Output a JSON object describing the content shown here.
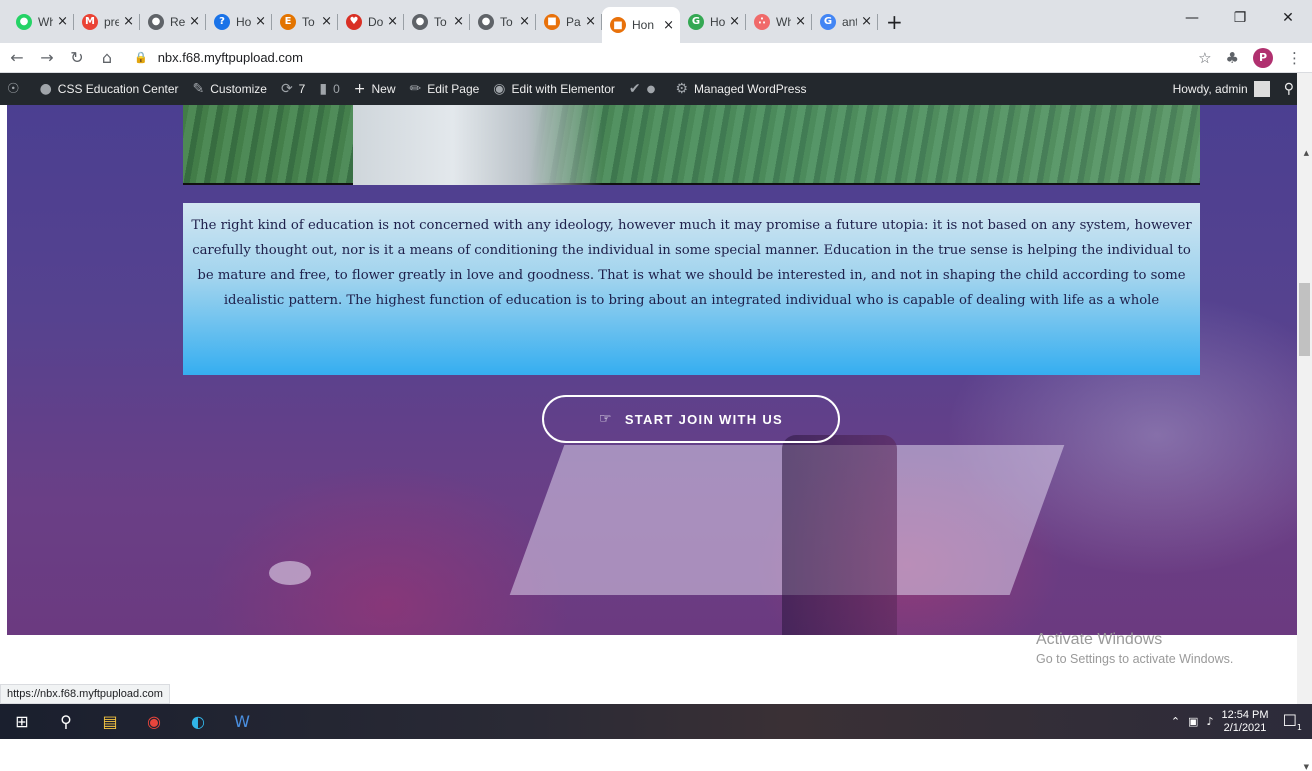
{
  "browser": {
    "tabs": [
      {
        "label": "Wha",
        "icon": "whatsapp-icon",
        "color": "#25d366",
        "glyph": "●"
      },
      {
        "label": "prep",
        "icon": "gmail-icon",
        "color": "#ea4335",
        "glyph": "M"
      },
      {
        "label": "Repo",
        "icon": "globe-icon",
        "color": "#5f6368",
        "glyph": "●"
      },
      {
        "label": "How",
        "icon": "quora-icon",
        "color": "#1a73e8",
        "glyph": "?"
      },
      {
        "label": "To th",
        "icon": "elementor-e-icon",
        "color": "#e37400",
        "glyph": "E"
      },
      {
        "label": "Dow",
        "icon": "heart-icon",
        "color": "#d93025",
        "glyph": "♥"
      },
      {
        "label": "To th",
        "icon": "globe-icon",
        "color": "#5f6368",
        "glyph": "●"
      },
      {
        "label": "To th",
        "icon": "globe-icon",
        "color": "#5f6368",
        "glyph": "●"
      },
      {
        "label": "Page",
        "icon": "site-icon",
        "color": "#e8710a",
        "glyph": "■"
      },
      {
        "label": "Hon",
        "icon": "site-icon",
        "color": "#e8710a",
        "glyph": "■",
        "active": true
      },
      {
        "label": "How",
        "icon": "gp-icon",
        "color": "#34a853",
        "glyph": "G"
      },
      {
        "label": "Wha",
        "icon": "asana-icon",
        "color": "#f06a6a",
        "glyph": "∴"
      },
      {
        "label": "anto",
        "icon": "google-icon",
        "color": "#4285f4",
        "glyph": "G"
      }
    ],
    "url": "nbx.f68.myftpupload.com",
    "profile_initial": "P",
    "status_url": "https://nbx.f68.myftpupload.com"
  },
  "wpbar": {
    "site_name": "CSS Education Center",
    "customize": "Customize",
    "updates_count": "7",
    "comments_count": "0",
    "new": "New",
    "edit_page": "Edit Page",
    "edit_elementor": "Edit with Elementor",
    "managed": "Managed WordPress",
    "howdy": "Howdy, admin"
  },
  "content": {
    "quote": "The right kind of education is not concerned with any ideology, however much it may promise a future utopia: it is not based on any system, however carefully thought out, nor is it a means of conditioning the individual in some special manner. Education in the true sense is helping the individual to be mature and free, to flower greatly in love and goodness. That is what we should be interested in, and not in shaping the child according to some idealistic pattern. The highest function of education is to bring about an integrated individual who is capable of dealing with life as a whole",
    "cta_label": "START JOIN WITH US"
  },
  "watermark": {
    "line1": "Activate Windows",
    "line2": "Go to Settings to activate Windows."
  },
  "taskbar": {
    "time": "12:54 PM",
    "date": "2/1/2021",
    "notification_count": "1"
  }
}
